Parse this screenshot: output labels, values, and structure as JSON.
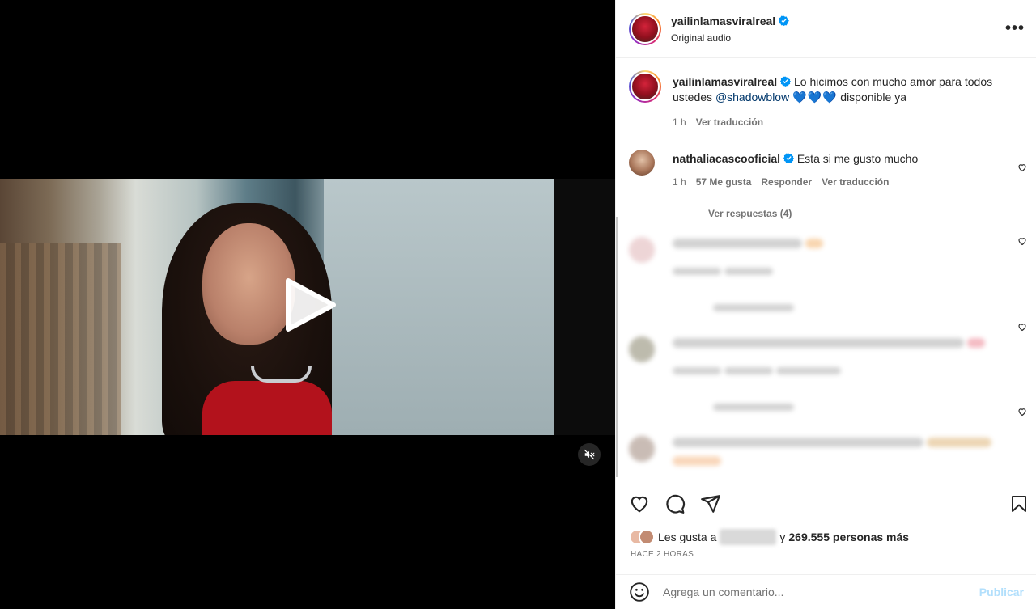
{
  "post": {
    "username": "yailinlamasviralreal",
    "audio": "Original audio",
    "more_label": "•••"
  },
  "caption": {
    "username": "yailinlamasviralreal",
    "text_before": "Lo hicimos con mucho amor para todos ustedes",
    "mention": "@shadowblow",
    "hearts": "💙💙💙",
    "text_after": "disponible ya",
    "time": "1 h",
    "translate": "Ver traducción"
  },
  "comments": [
    {
      "username": "nathaliacascooficial",
      "text": "Esta si me gusto mucho",
      "time": "1 h",
      "likes": "57 Me gusta",
      "reply": "Responder",
      "translate": "Ver traducción",
      "replies": "Ver respuestas (4)"
    }
  ],
  "likes": {
    "prefix": "Les gusta a",
    "connector": "y",
    "count_text": "269.555 personas más"
  },
  "date": "HACE 2 HORAS",
  "composer": {
    "placeholder": "Agrega un comentario...",
    "publish": "Publicar"
  },
  "colors": {
    "verified": "#0095f6",
    "link": "#00376b",
    "publish_disabled": "#b2dffc"
  }
}
